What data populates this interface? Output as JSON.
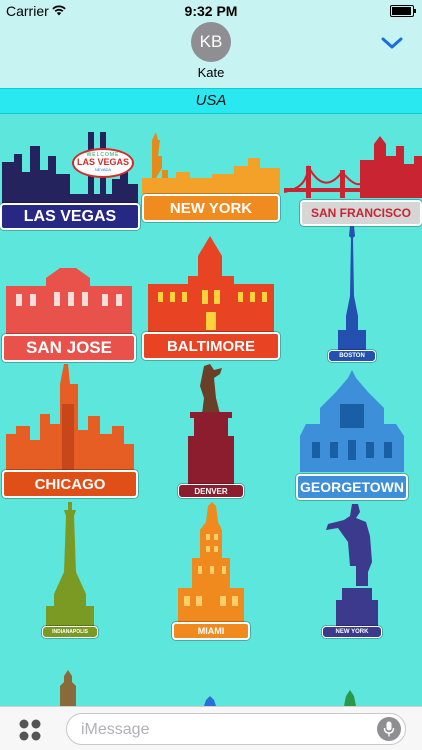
{
  "status_bar": {
    "carrier": "Carrier",
    "time": "9:32 PM"
  },
  "header": {
    "avatar_initials": "KB",
    "contact_name": "Kate"
  },
  "category": {
    "title": "USA"
  },
  "stickers": {
    "las_vegas": "LAS VEGAS",
    "las_vegas_sign_top": "WELCOME",
    "las_vegas_sign_main": "LAS VEGAS",
    "las_vegas_sign_bottom": "NEVADA",
    "new_york": "NEW YORK",
    "san_francisco": "SAN FRANCISCO",
    "san_jose": "SAN JOSE",
    "baltimore": "BALTIMORE",
    "boston": "BOSTON",
    "chicago": "CHICAGO",
    "denver": "DENVER",
    "georgetown": "GEORGETOWN",
    "indianapolis": "INDIANAPOLIS",
    "miami": "MIAMI",
    "new_york_statue": "NEW YORK"
  },
  "input": {
    "placeholder": "iMessage"
  },
  "colors": {
    "background": "#5ce6dc",
    "header": "#c7f3f2",
    "category_bar": "#2ae8f0",
    "accent": "#1a6fe0"
  }
}
